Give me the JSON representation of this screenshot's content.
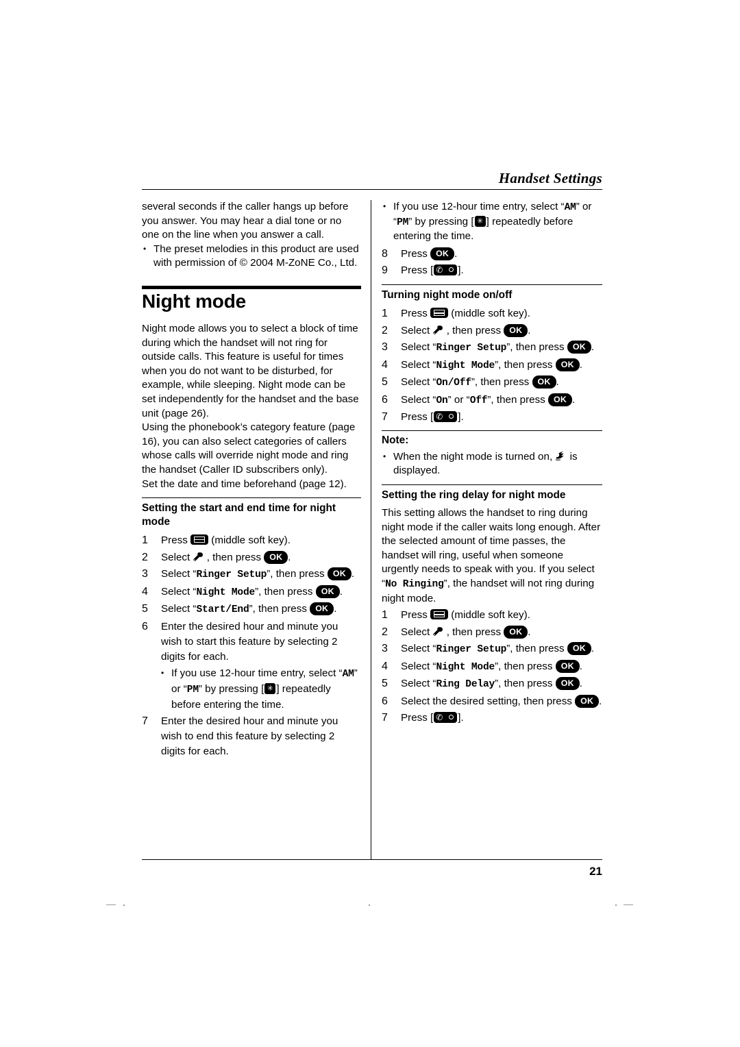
{
  "header": {
    "title": "Handset Settings"
  },
  "page_number": "21",
  "left_column": {
    "continued_paragraph": "several seconds if the caller hangs up before you answer. You may hear a dial tone or no one on the line when you answer a call.",
    "bullet_1": "The preset melodies in this product are used with permission of © 2004 M-ZoNE Co., Ltd.",
    "chapter_title": "Night mode",
    "intro_paragraph_1": "Night mode allows you to select a block of time during which the handset will not ring for outside calls. This feature is useful for times when you do not want to be disturbed, for example, while sleeping. Night mode can be set independently for the handset and the base unit (page 26).",
    "intro_paragraph_2": "Using the phonebook’s category feature (page 16), you can also select categories of callers whose calls will override night mode and ring the handset (Caller ID subscribers only).",
    "intro_paragraph_3": "Set the date and time beforehand (page 12).",
    "section_heading": "Setting the start and end time for night mode",
    "steps": [
      {
        "num": "1",
        "before": "Press",
        "icon": "soft-key-icon",
        "after": "(middle soft key)."
      },
      {
        "num": "2",
        "before": "Select",
        "icon": "wrench-icon",
        "mid": ", then press",
        "ok": "OK",
        "after": "."
      },
      {
        "num": "3",
        "before": "Select “",
        "mono": "Ringer Setup",
        "mid": "”, then press",
        "ok": "OK",
        "after": "."
      },
      {
        "num": "4",
        "before": "Select “",
        "mono": "Night Mode",
        "mid": "”, then press",
        "ok": "OK",
        "after": "."
      },
      {
        "num": "5",
        "before": "Select “",
        "mono": "Start/End",
        "mid": "”, then press",
        "ok": "OK",
        "after": "."
      },
      {
        "num": "6",
        "text": "Enter the desired hour and minute you wish to start this feature by selecting 2 digits for each.",
        "sub_before": "If you use 12-hour time entry, select “",
        "sub_mono_1": "AM",
        "sub_mid": "” or “",
        "sub_mono_2": "PM",
        "sub_after": "” by pressing",
        "sub_tail": "repeatedly before entering the time."
      },
      {
        "num": "7",
        "text": "Enter the desired hour and minute you wish to end this feature by selecting 2 digits for each."
      }
    ]
  },
  "right_column": {
    "top_bullet": {
      "before": "If you use 12-hour time entry, select “",
      "mono_1": "AM",
      "mid": "” or “",
      "mono_2": "PM",
      "after": "” by pressing",
      "tail": "repeatedly before entering the time."
    },
    "step_8": {
      "num": "8",
      "before": "Press",
      "ok": "OK",
      "after": "."
    },
    "step_9": {
      "num": "9",
      "before": "Press",
      "after": "."
    },
    "section_1_heading": "Turning night mode on/off",
    "section_1_steps": [
      {
        "num": "1",
        "before": "Press",
        "icon": "soft-key-icon",
        "after": "(middle soft key)."
      },
      {
        "num": "2",
        "before": "Select",
        "icon": "wrench-icon",
        "mid": ", then press",
        "ok": "OK",
        "after": "."
      },
      {
        "num": "3",
        "before": "Select “",
        "mono": "Ringer Setup",
        "mid": "”, then press",
        "ok": "OK",
        "after": "."
      },
      {
        "num": "4",
        "before": "Select “",
        "mono": "Night Mode",
        "mid": "”, then press",
        "ok": "OK",
        "after": "."
      },
      {
        "num": "5",
        "before": "Select “",
        "mono": "On/Off",
        "mid": "”, then press",
        "ok": "OK",
        "after": "."
      },
      {
        "num": "6",
        "before": "Select “",
        "mono": "On",
        "mid": "” or “",
        "mono_2": "Off",
        "mid_2": "”, then press",
        "ok": "OK",
        "after": "."
      },
      {
        "num": "7",
        "before": "Press",
        "after": "."
      }
    ],
    "note_heading": "Note:",
    "note_bullet": {
      "before": "When the night mode is turned on,",
      "after": "is displayed."
    },
    "section_2_heading": "Setting the ring delay for night mode",
    "section_2_paragraph": {
      "before": "This setting allows the handset to ring during night mode if the caller waits long enough. After the selected amount of time passes, the handset will ring, useful when someone urgently needs to speak with you. If you select “",
      "mono": "No Ringing",
      "after": "”, the handset will not ring during night mode."
    },
    "section_2_steps": [
      {
        "num": "1",
        "before": "Press",
        "icon": "soft-key-icon",
        "after": "(middle soft key)."
      },
      {
        "num": "2",
        "before": "Select",
        "icon": "wrench-icon",
        "mid": ", then press",
        "ok": "OK",
        "after": "."
      },
      {
        "num": "3",
        "before": "Select “",
        "mono": "Ringer Setup",
        "mid": "”, then press",
        "ok": "OK",
        "after": "."
      },
      {
        "num": "4",
        "before": "Select “",
        "mono": "Night Mode",
        "mid": "”, then press",
        "ok": "OK",
        "after": "."
      },
      {
        "num": "5",
        "before": "Select “",
        "mono": "Ring Delay",
        "mid": "”, then press",
        "ok": "OK",
        "after": "."
      },
      {
        "num": "6",
        "before": "Select the desired setting, then press",
        "ok": "OK",
        "after": "."
      },
      {
        "num": "7",
        "before": "Press",
        "after": "."
      }
    ]
  },
  "icons": {
    "soft_key": "soft-key-icon",
    "wrench": "wrench-icon",
    "star_key": "star-key-icon",
    "off_key": "off-key-icon",
    "night_mode": "night-mode-icon",
    "ok_label": "OK"
  }
}
